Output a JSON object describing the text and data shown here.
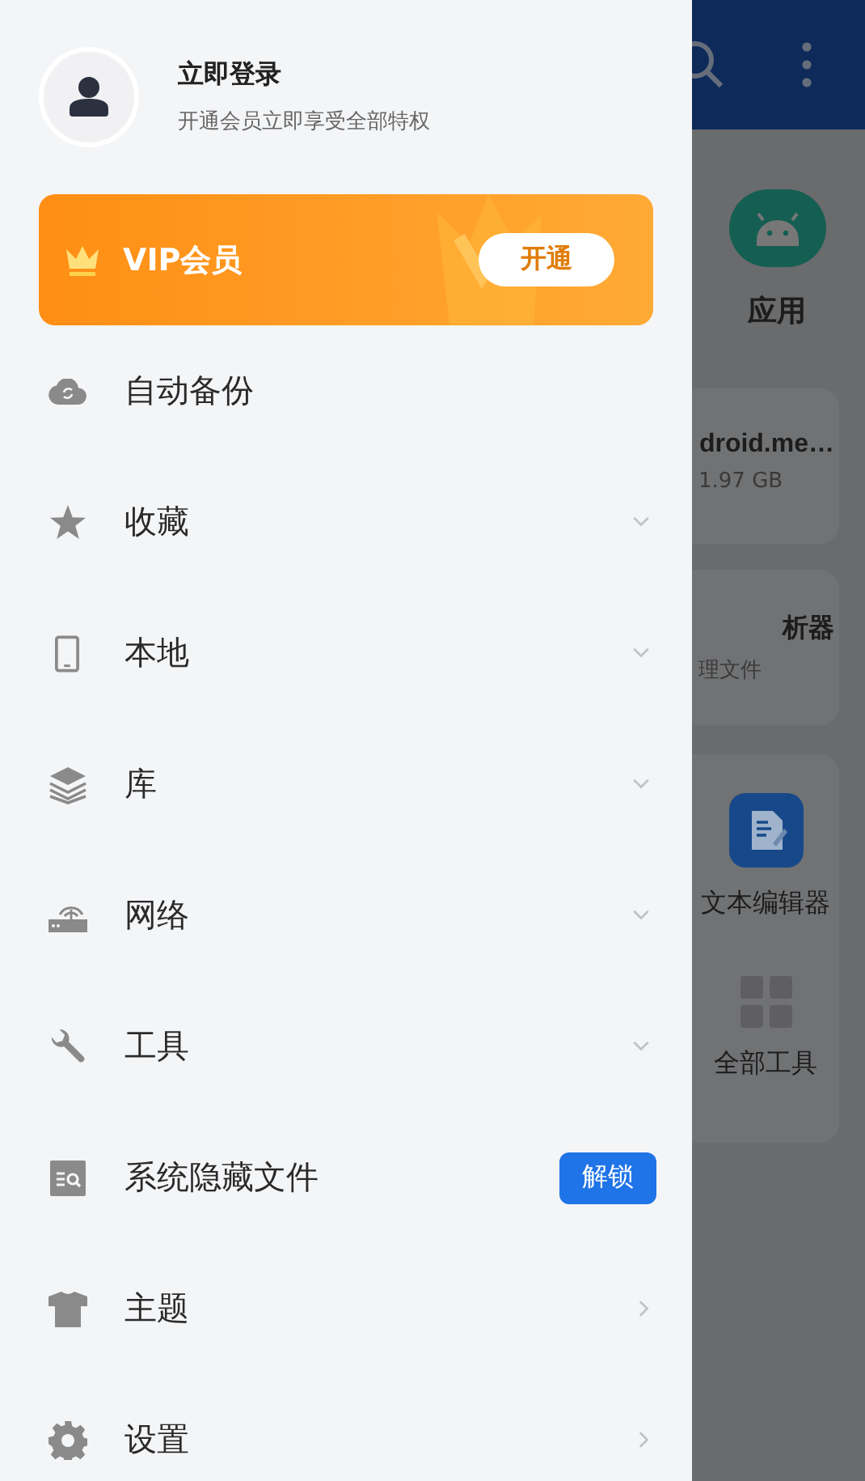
{
  "profile": {
    "title": "立即登录",
    "subtitle": "开通会员立即享受全部特权"
  },
  "vip": {
    "label": "VIP会员",
    "button": "开通"
  },
  "menu": [
    {
      "label": "自动备份",
      "kind": "plain"
    },
    {
      "label": "收藏",
      "kind": "expandable"
    },
    {
      "label": "本地",
      "kind": "expandable"
    },
    {
      "label": "库",
      "kind": "expandable"
    },
    {
      "label": "网络",
      "kind": "expandable"
    },
    {
      "label": "工具",
      "kind": "expandable"
    },
    {
      "label": "系统隐藏文件",
      "kind": "badge",
      "badge": "解锁"
    },
    {
      "label": "主题",
      "kind": "link"
    },
    {
      "label": "设置",
      "kind": "link"
    }
  ],
  "background": {
    "app_label": "应用",
    "cards": [
      {
        "title": "droid.me…",
        "subtitle": "1.97 GB"
      },
      {
        "title": "析器",
        "subtitle": "理文件"
      }
    ],
    "tools": [
      {
        "label": "文本编辑器"
      },
      {
        "label": "全部工具"
      }
    ]
  }
}
